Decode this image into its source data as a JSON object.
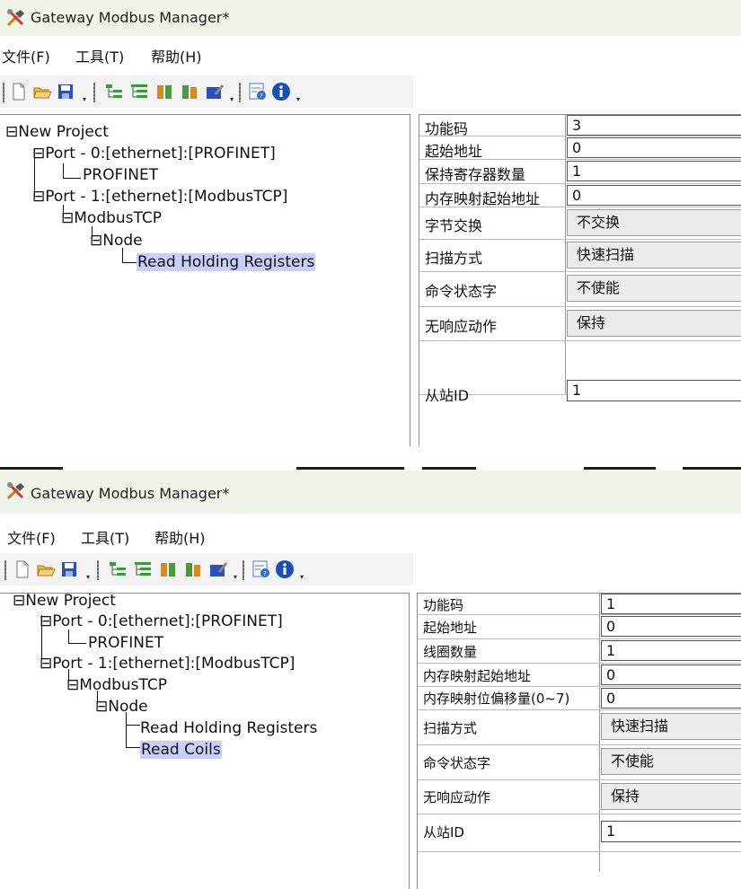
{
  "window_a": {
    "title": "Gateway Modbus Manager*",
    "menu": [
      "文件(F)",
      "工具(T)",
      "帮助(H)"
    ],
    "tree": {
      "root": "New Project",
      "port0": "Port - 0:[ethernet]:[PROFINET]",
      "port0_child": "PROFINET",
      "port1": "Port - 1:[ethernet]:[ModbusTCP]",
      "modbus": "ModbusTCP",
      "node": "Node",
      "cmd1": "Read Holding Registers"
    },
    "props": [
      {
        "name": "功能码",
        "value": "3"
      },
      {
        "name": "起始地址",
        "value": "0"
      },
      {
        "name": "保持寄存器数量",
        "value": "1"
      },
      {
        "name": "内存映射起始地址",
        "value": "0"
      },
      {
        "name": "字节交换",
        "value": "不交换"
      },
      {
        "name": "扫描方式",
        "value": "快速扫描"
      },
      {
        "name": "命令状态字",
        "value": "不使能"
      },
      {
        "name": "无响应动作",
        "value": "保持"
      },
      {
        "name": "从站ID",
        "value": "1"
      }
    ]
  },
  "window_b": {
    "title": "Gateway Modbus Manager*",
    "menu": [
      "文件(F)",
      "工具(T)",
      "帮助(H)"
    ],
    "tree": {
      "root": "New Project",
      "port0": "Port - 0:[ethernet]:[PROFINET]",
      "port0_child": "PROFINET",
      "port1": "Port - 1:[ethernet]:[ModbusTCP]",
      "modbus": "ModbusTCP",
      "node": "Node",
      "cmd1": "Read Holding Registers",
      "cmd2": "Read Coils"
    },
    "props": [
      {
        "name": "功能码",
        "value": "1"
      },
      {
        "name": "起始地址",
        "value": "0"
      },
      {
        "name": "线圈数量",
        "value": "1"
      },
      {
        "name": "内存映射起始地址",
        "value": "0"
      },
      {
        "name": "内存映射位偏移量(0~7)",
        "value": "0"
      },
      {
        "name": "扫描方式",
        "value": "快速扫描"
      },
      {
        "name": "命令状态字",
        "value": "不使能"
      },
      {
        "name": "无响应动作",
        "value": "保持"
      },
      {
        "name": "从站ID",
        "value": "1"
      }
    ]
  },
  "toolbar_icons": [
    "new-file-icon",
    "open-folder-icon",
    "save-icon",
    "add-node-icon",
    "add-command-icon",
    "copy-command-icon",
    "paste-command-icon",
    "edit-icon",
    "help-icon",
    "info-icon"
  ],
  "colors": {
    "titlebar": "#eef4e8",
    "selection": "#c9cff9",
    "save_blue": "#2a4fc1",
    "folder_yellow": "#e7b94a",
    "green_icon": "#3a9a3a"
  }
}
